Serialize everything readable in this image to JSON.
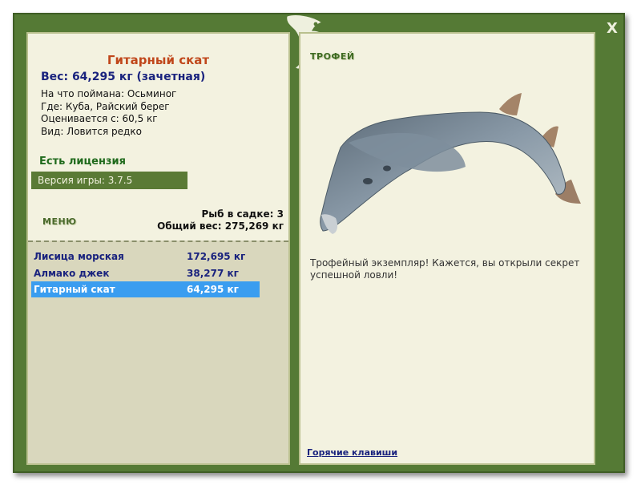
{
  "window": {
    "close_label": "X"
  },
  "fish": {
    "title": "Гитарный скат",
    "weight": "Вес: 64,295 кг (зачетная)",
    "bait": "На что поймана: Осьминог",
    "location": "Где: Куба, Райский берег",
    "value": "Оценивается с: 60,5 кг",
    "kind": "Вид: Ловится редко"
  },
  "license": "Есть лицензия",
  "version": "Версия игры: 3.7.5",
  "menu_label": "МЕНЮ",
  "stats": {
    "count": "Рыб в садке: 3",
    "total": "Общий вес: 275,269 кг"
  },
  "catch": [
    {
      "name": "Лисица морская",
      "weight": "172,695 кг",
      "selected": false
    },
    {
      "name": "Алмако джек",
      "weight": "38,277 кг",
      "selected": false
    },
    {
      "name": "Гитарный скат",
      "weight": "64,295 кг",
      "selected": true
    }
  ],
  "trophy": {
    "label": "ТРОФЕЙ",
    "text": "Трофейный экземпляр! Кажется, вы открыли секрет успешной ловли!",
    "hotkeys": "Горячие клавиши"
  },
  "colors": {
    "frame": "#557a35",
    "panel": "#f3f2e0",
    "selected_row": "#3a9df0",
    "title": "#c0471b",
    "navy_text": "#1a237e"
  },
  "icons": {
    "logo": "chameleon-logo-icon",
    "close": "close-icon",
    "fish": "guitarfish-image"
  }
}
